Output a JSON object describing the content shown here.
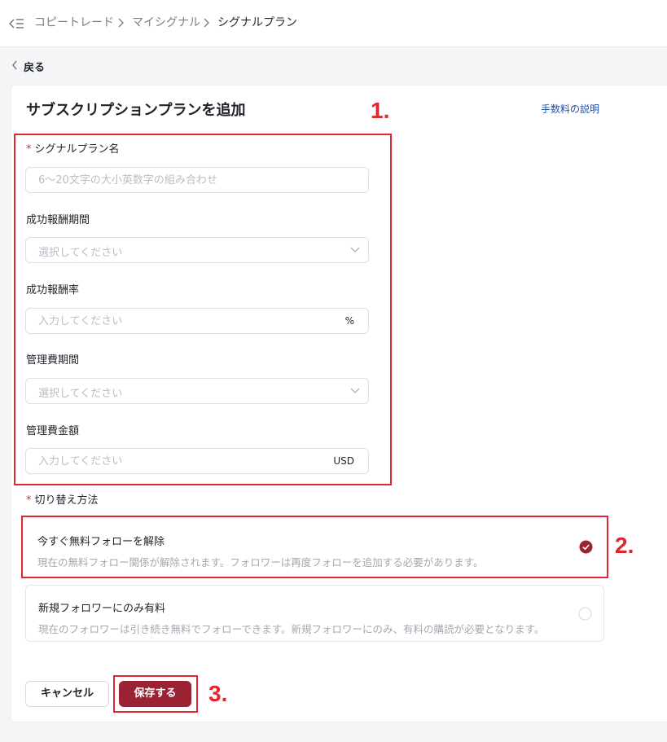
{
  "breadcrumb": {
    "items": [
      "コピートレード",
      "マイシグナル",
      "シグナルプラン"
    ]
  },
  "back_label": "戻る",
  "page_title": "サブスクリプションプランを追加",
  "fee_link": "手数料の説明",
  "required_mark": "*",
  "form": {
    "plan_name": {
      "label": "シグナルプラン名",
      "value": "",
      "placeholder": "6～20文字の大小英数字の組み合わせ"
    },
    "success_fee_period": {
      "label": "成功報酬期間",
      "value": "",
      "placeholder": "選択してください"
    },
    "success_fee_rate": {
      "label": "成功報酬率",
      "value": "",
      "placeholder": "入力してください",
      "suffix": "%"
    },
    "mgmt_fee_period": {
      "label": "管理費期間",
      "value": "",
      "placeholder": "選択してください"
    },
    "mgmt_fee_amount": {
      "label": "管理費金額",
      "value": "",
      "placeholder": "入力してください",
      "suffix": "USD"
    }
  },
  "switch_method": {
    "label": "切り替え方法",
    "options": [
      {
        "title": "今すぐ無料フォローを解除",
        "desc": "現在の無料フォロー関係が解除されます。フォロワーは再度フォローを追加する必要があります。",
        "selected": true
      },
      {
        "title": "新規フォロワーにのみ有料",
        "desc": "現在のフォロワーは引き続き無料でフォローできます。新規フォロワーにのみ、有料の購読が必要となります。",
        "selected": false
      }
    ]
  },
  "buttons": {
    "cancel": "キャンセル",
    "save": "保存する"
  },
  "annotations": [
    "1.",
    "2.",
    "3."
  ],
  "colors": {
    "accent": "#9b2233",
    "annotation": "#e0262e",
    "link": "#1f4fa0"
  },
  "icons": {
    "collapse": "sidebar-collapse-icon",
    "chevron": "chevron-right-icon",
    "back": "chevron-left-icon",
    "dropdown": "chevron-down-icon",
    "check": "check-icon"
  }
}
